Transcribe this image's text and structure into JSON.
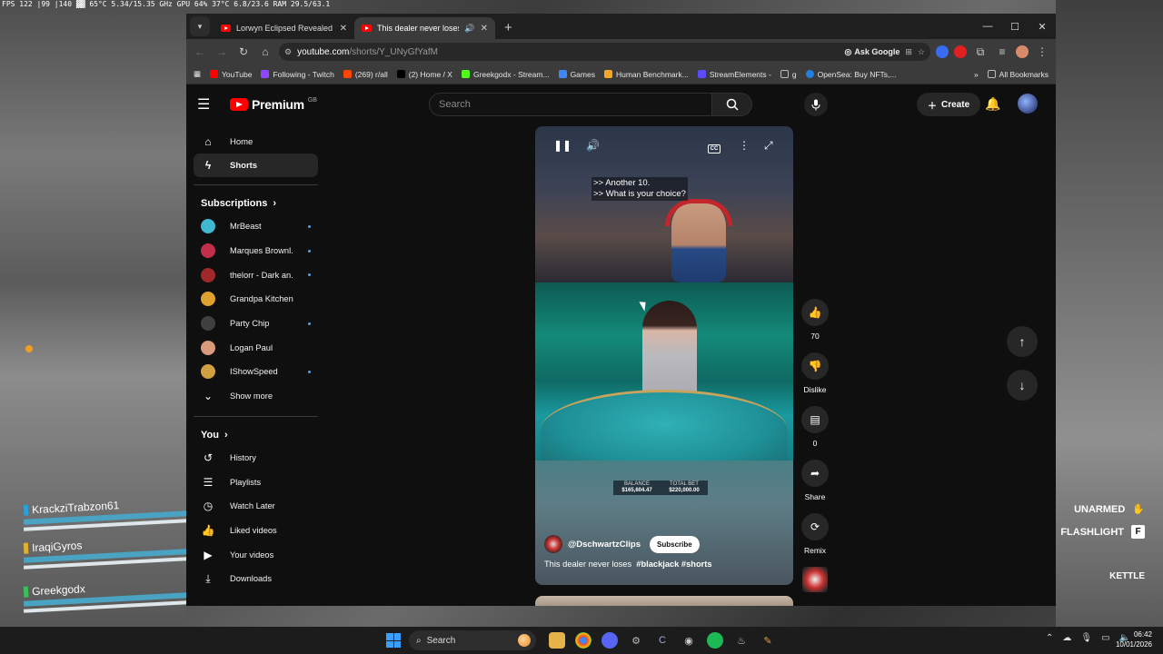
{
  "hud": {
    "stats": "FPS 122 |99 |140   ▓▓ 65°C 5.34/15.35 GHz GPU 64%  37°C 6.8/23.6   RAM 29.5/63.1",
    "squad": [
      {
        "name": "KrackziTrabzon61",
        "color": "#2ba0d8"
      },
      {
        "name": "IraqiGyros",
        "color": "#e0b030"
      },
      {
        "name": "Greekgodx",
        "color": "#3bbd5a"
      }
    ],
    "unarmed": "UNARMED",
    "flashlight": "FLASHLIGHT",
    "flashlight_key": "F",
    "kettle": "KETTLE"
  },
  "browser": {
    "tabs": [
      {
        "title": "Lorwyn Eclipsed Revealed | Gam",
        "active": false
      },
      {
        "title": "This dealer never loses #blackj",
        "active": true
      }
    ],
    "url_domain": "youtube.com",
    "url_path": "/shorts/Y_UNyGfYafM",
    "ask_google": "Ask Google",
    "bookmarks": [
      {
        "label": "YouTube",
        "color": "#ff0000"
      },
      {
        "label": "Following - Twitch",
        "color": "#9146ff"
      },
      {
        "label": "(269) r/all",
        "color": "#ff4500"
      },
      {
        "label": "(2) Home / X",
        "color": "#000000"
      },
      {
        "label": "Greekgodx - Stream...",
        "color": "#53fc18"
      },
      {
        "label": "Games",
        "color": "#4285f4"
      },
      {
        "label": "Human Benchmark...",
        "color": "#f5a623"
      },
      {
        "label": "StreamElements -",
        "color": "#5c4bff"
      },
      {
        "label": "g",
        "color": "#bbbbbb"
      },
      {
        "label": "OpenSea: Buy NFTs,...",
        "color": "#2081e2"
      }
    ],
    "all_bookmarks": "All Bookmarks"
  },
  "youtube": {
    "logo_text": "Premium",
    "logo_region": "GB",
    "search_placeholder": "Search",
    "create_label": "Create",
    "nav": [
      {
        "label": "Home",
        "icon": "home-icon"
      },
      {
        "label": "Shorts",
        "icon": "shorts-icon"
      }
    ],
    "subscriptions_title": "Subscriptions",
    "subscriptions": [
      {
        "name": "MrBeast",
        "color": "#3fb8d0",
        "live": true
      },
      {
        "name": "Marques Brownl...",
        "color": "#c0304a",
        "live": true
      },
      {
        "name": "thelorr - Dark an...",
        "color": "#a02828",
        "live": true
      },
      {
        "name": "Grandpa Kitchen",
        "color": "#e0a030",
        "live": false
      },
      {
        "name": "Party Chip",
        "color": "#404040",
        "live": true
      },
      {
        "name": "Logan Paul",
        "color": "#d89a7a",
        "live": false
      },
      {
        "name": "IShowSpeed",
        "color": "#d0a040",
        "live": true
      }
    ],
    "show_more": "Show more",
    "you_title": "You",
    "you_items": [
      {
        "label": "History",
        "icon": "history-icon"
      },
      {
        "label": "Playlists",
        "icon": "playlists-icon"
      },
      {
        "label": "Watch Later",
        "icon": "watch-later-icon"
      },
      {
        "label": "Liked videos",
        "icon": "liked-icon"
      },
      {
        "label": "Your videos",
        "icon": "your-videos-icon"
      },
      {
        "label": "Downloads",
        "icon": "downloads-icon"
      }
    ],
    "short": {
      "caption_line1": ">> Another 10.",
      "caption_line2": ">> What is your choice?",
      "balance_label": "BALANCE",
      "balance_value": "$165,604.47",
      "bet_label": "TOTAL BET",
      "bet_value": "$220,000.00",
      "channel": "@DschwartzClips",
      "subscribe": "Subscribe",
      "title": "This dealer never loses",
      "hashtags": "#blackjack #shorts",
      "cc": "CC"
    },
    "actions": {
      "likes": "70",
      "dislike": "Dislike",
      "comments": "0",
      "share": "Share",
      "remix": "Remix"
    }
  },
  "taskbar": {
    "search": "Search",
    "time": "06:42",
    "date": "10/01/2026"
  }
}
